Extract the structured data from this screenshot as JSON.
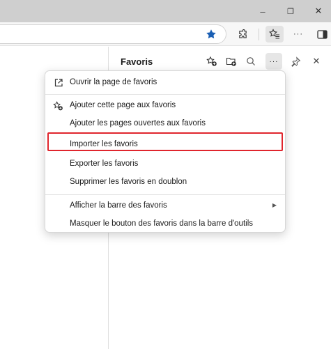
{
  "window": {
    "minimize_glyph": "–",
    "restore_glyph": "❐",
    "close_glyph": "✕"
  },
  "toolbar": {
    "more_glyph": "···"
  },
  "panel": {
    "title": "Favoris",
    "more_glyph": "···",
    "close_glyph": "✕"
  },
  "menu": {
    "items": [
      {
        "label": "Ouvrir la page de favoris",
        "icon": "open-external-icon"
      },
      {
        "label": "Ajouter cette page aux favoris",
        "icon": "add-favorite-icon"
      },
      {
        "label": "Ajouter les pages ouvertes aux favoris",
        "icon": ""
      },
      {
        "label": "Importer les favoris",
        "icon": "",
        "highlighted": true
      },
      {
        "label": "Exporter les favoris",
        "icon": ""
      },
      {
        "label": "Supprimer les favoris en doublon",
        "icon": ""
      },
      {
        "label": "Afficher la barre des favoris",
        "icon": "",
        "submenu": true
      },
      {
        "label": "Masquer le bouton des favoris dans la barre d'outils",
        "icon": ""
      }
    ],
    "submenu_arrow": "▶"
  },
  "colors": {
    "star": "#1a5fb4",
    "highlight": "#e0252d",
    "titlebar": "#cfcfcf"
  }
}
